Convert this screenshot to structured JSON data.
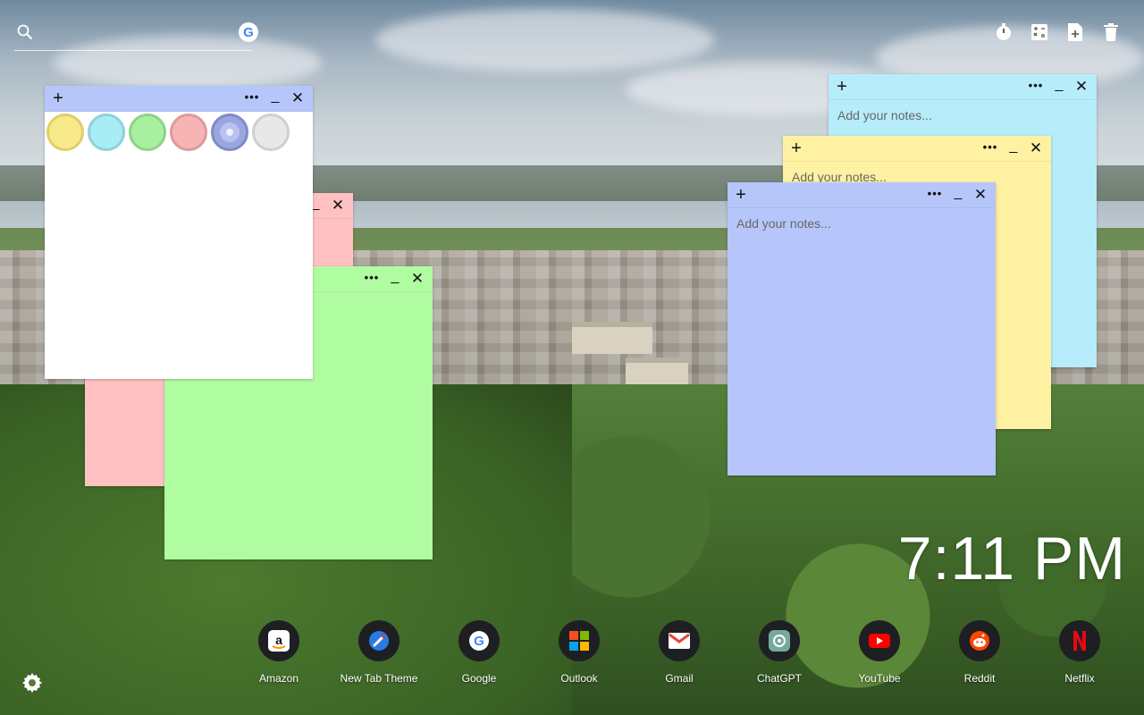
{
  "search": {
    "icon": "search-icon",
    "engine_icon": "google-icon",
    "engine_letter": "G",
    "placeholder": ""
  },
  "toolbar": {
    "tools": [
      {
        "icon": "timer-icon"
      },
      {
        "icon": "calculator-icon"
      },
      {
        "icon": "add-note-icon"
      },
      {
        "icon": "trash-icon"
      }
    ]
  },
  "notes": {
    "white": {
      "color": "#ffffff",
      "add": "+",
      "more": "•••",
      "minimize": "_",
      "close": "✕",
      "palette": [
        "#f8e98a",
        "#a8ecf6",
        "#a8f0a0",
        "#f7b4b4",
        "#9aa6e0",
        "#e8e8e8"
      ]
    },
    "pink": {
      "color": "#ffc1c1",
      "close": "✕",
      "minimize": "_"
    },
    "green": {
      "color": "#b0fca0",
      "more": "•••",
      "minimize": "_",
      "close": "✕"
    },
    "cyan": {
      "color": "#b7ecfb",
      "add": "+",
      "more": "•••",
      "minimize": "_",
      "close": "✕",
      "placeholder": "Add your notes..."
    },
    "yellow": {
      "color": "#fff1a2",
      "add": "+",
      "more": "•••",
      "minimize": "_",
      "close": "✕",
      "placeholder": "Add your notes..."
    },
    "blue": {
      "color": "#b6c6fb",
      "add": "+",
      "more": "•••",
      "minimize": "_",
      "close": "✕",
      "placeholder": "Add your notes..."
    }
  },
  "clock": {
    "time": "7:11 PM"
  },
  "dock": {
    "apps": [
      {
        "label": "Amazon",
        "icon": "amazon-icon"
      },
      {
        "label": "New Tab Theme",
        "icon": "new-tab-theme-icon"
      },
      {
        "label": "Google",
        "icon": "google-icon"
      },
      {
        "label": "Outlook",
        "icon": "microsoft-icon"
      },
      {
        "label": "Gmail",
        "icon": "gmail-icon"
      },
      {
        "label": "ChatGPT",
        "icon": "chatgpt-icon"
      },
      {
        "label": "YouTube",
        "icon": "youtube-icon"
      },
      {
        "label": "Reddit",
        "icon": "reddit-icon"
      },
      {
        "label": "Netflix",
        "icon": "netflix-icon"
      }
    ]
  },
  "settings": {
    "icon": "gear-icon"
  }
}
